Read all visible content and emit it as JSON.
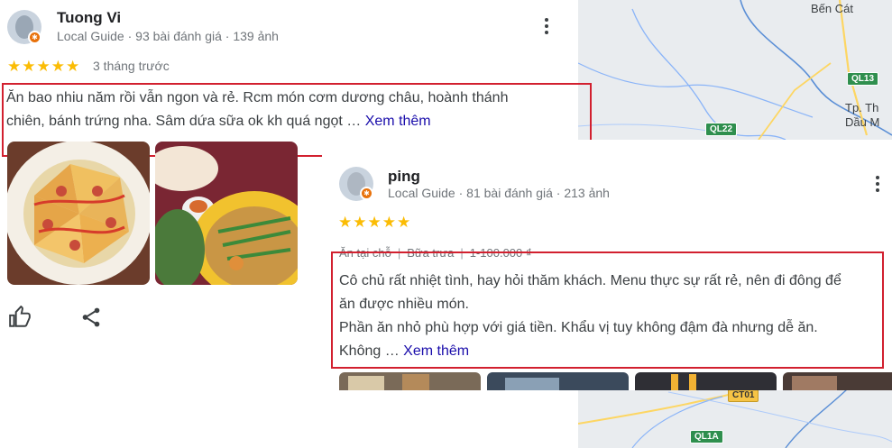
{
  "map": {
    "labels": {
      "ben_cat": "Bến Cát",
      "tp_thu_dau_mot_1": "Tp. Th",
      "tp_thu_dau_mot_2": "Dầu M"
    },
    "shields": {
      "ql13": "QL13",
      "ql22": "QL22",
      "ct01": "CT01",
      "ql1a": "QL1A"
    }
  },
  "review1": {
    "author": "Tuong Vi",
    "meta": "Local Guide · 93 bài đánh giá · 139 ảnh",
    "stars": "★★★★★",
    "rating": 5,
    "when": "3 tháng trước",
    "text_line1": "Ăn bao nhiu năm rồi vẫn ngon và rẻ. Rcm món cơm dương châu, hoành thánh",
    "text_line2": "chiên, bánh trứng nha. Sâm dứa sữa ok kh quá ngọt …",
    "see_more": "Xem thêm"
  },
  "review2": {
    "author": "ping",
    "meta": "Local Guide · 81 bài đánh giá · 213 ảnh",
    "stars": "★★★★★",
    "rating": 5,
    "tags": [
      "Ăn tại chỗ",
      "Bữa trưa",
      "1-100.000 ₫"
    ],
    "tag_sep": "|",
    "text_line1": "Cô chủ rất nhiệt tình, hay hỏi thăm khách. Menu thực sự rất rẻ, nên đi đông để",
    "text_line2": "ăn được nhiều món.",
    "text_line3": "Phần ăn nhỏ phù hợp với giá tiền. Khẩu vị tuy không đậm đà nhưng dễ ăn.",
    "text_line4": "Không …",
    "see_more": "Xem thêm"
  },
  "colors": {
    "star": "#fbbc04",
    "link": "#1a0dab",
    "highlight": "#d2202f",
    "guide_badge": "#e8710a"
  },
  "icons": [
    "more-vert-icon",
    "thumbs-up-icon",
    "share-icon",
    "local-guide-badge-icon"
  ]
}
